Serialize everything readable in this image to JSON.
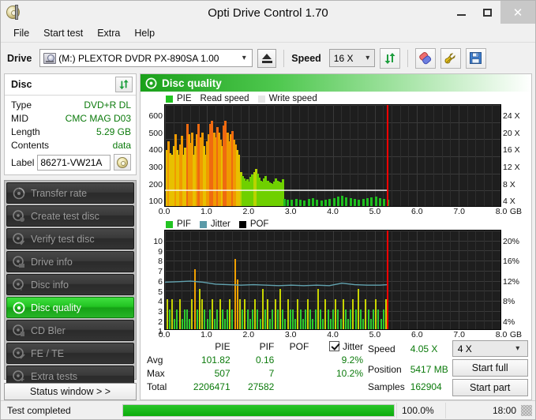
{
  "window": {
    "title": "Opti Drive Control 1.70",
    "icon": "disc-drive-icon",
    "minimize": "–",
    "maximize": "□",
    "close": "✕"
  },
  "menu": {
    "items": [
      "File",
      "Start test",
      "Extra",
      "Help"
    ]
  },
  "toolbar": {
    "drive_label": "Drive",
    "drive_value": "(M:)  PLEXTOR DVDR   PX-890SA 1.00",
    "eject_icon": "eject-icon",
    "speed_label": "Speed",
    "speed_value": "16 X",
    "refresh_icon": "refresh-icon",
    "eraser_icon": "eraser-icon",
    "tools_icon": "tools-icon",
    "save_icon": "save-icon"
  },
  "disc_panel": {
    "title": "Disc",
    "refresh_icon": "refresh-icon",
    "rows": [
      {
        "key": "Type",
        "value": "DVD+R DL"
      },
      {
        "key": "MID",
        "value": "CMC MAG D03"
      },
      {
        "key": "Length",
        "value": "5.29 GB"
      },
      {
        "key": "Contents",
        "value": "data"
      }
    ],
    "label_key": "Label",
    "label_value": "86271-VW21A",
    "label_button_icon": "disc-icon"
  },
  "nav": {
    "items": [
      {
        "label": "Transfer rate",
        "icon": "disc-transfer-icon",
        "active": false
      },
      {
        "label": "Create test disc",
        "icon": "disc-create-icon",
        "active": false
      },
      {
        "label": "Verify test disc",
        "icon": "disc-verify-icon",
        "active": false
      },
      {
        "label": "Drive info",
        "icon": "disc-drive-info-icon",
        "active": false
      },
      {
        "label": "Disc info",
        "icon": "disc-info-icon",
        "active": false
      },
      {
        "label": "Disc quality",
        "icon": "disc-quality-icon",
        "active": true
      },
      {
        "label": "CD Bler",
        "icon": "disc-bler-icon",
        "active": false
      },
      {
        "label": "FE / TE",
        "icon": "disc-fete-icon",
        "active": false
      },
      {
        "label": "Extra tests",
        "icon": "disc-extra-icon",
        "active": false
      }
    ],
    "status_button": "Status window > >"
  },
  "panel": {
    "header_title": "Disc quality",
    "header_icon": "disc-quality-icon"
  },
  "chart_data": [
    {
      "id": "pie-chart",
      "type": "bar",
      "title": "PIE / Read speed",
      "xlabel": "GB",
      "ylabel": "PIE",
      "xlim": [
        0,
        8.0
      ],
      "ylim": [
        0,
        600
      ],
      "y2lim": [
        0,
        24
      ],
      "y2label": "X",
      "grid": true,
      "xticks": [
        "0.0",
        "1.0",
        "2.0",
        "3.0",
        "4.0",
        "5.0",
        "6.0",
        "7.0",
        "8.0"
      ],
      "xtick_suffix": "GB",
      "yticks": [
        600,
        500,
        400,
        300,
        200,
        100
      ],
      "y2ticks": [
        "24 X",
        "20 X",
        "16 X",
        "12 X",
        "8 X",
        "4 X"
      ],
      "legend": [
        {
          "label": "PIE",
          "color": "#22c322"
        },
        {
          "label": "Read speed",
          "color": "#ffffff"
        },
        {
          "label": "Write speed",
          "color": "#e6e6e6"
        }
      ],
      "end_marker_gb": 5.29,
      "end_marker_color": "#ff0000",
      "read_speed_line_x": 4.05,
      "series": [
        {
          "name": "PIE",
          "x": [
            0.02,
            0.06,
            0.1,
            0.14,
            0.18,
            0.22,
            0.26,
            0.3,
            0.34,
            0.38,
            0.42,
            0.46,
            0.5,
            0.54,
            0.58,
            0.62,
            0.66,
            0.7,
            0.74,
            0.78,
            0.82,
            0.86,
            0.9,
            0.94,
            0.98,
            1.02,
            1.06,
            1.1,
            1.14,
            1.18,
            1.22,
            1.26,
            1.3,
            1.34,
            1.38,
            1.42,
            1.46,
            1.5,
            1.54,
            1.58,
            1.62,
            1.66,
            1.7,
            1.74,
            1.78,
            1.82,
            1.86,
            1.9,
            1.94,
            1.98,
            2.02,
            2.06,
            2.1,
            2.14,
            2.18,
            2.22,
            2.26,
            2.3,
            2.34,
            2.38,
            2.42,
            2.46,
            2.5,
            2.54,
            2.58,
            2.62,
            2.66,
            2.7,
            2.74,
            2.78,
            2.82,
            2.9,
            3.0,
            3.1,
            3.2,
            3.3,
            3.4,
            3.5,
            3.6,
            3.7,
            3.8,
            3.9,
            4.0,
            4.1,
            4.2,
            4.3,
            4.4,
            4.5,
            4.6,
            4.7,
            4.8,
            4.9,
            5.0,
            5.1,
            5.2,
            5.28
          ],
          "values": [
            330,
            380,
            310,
            300,
            350,
            420,
            330,
            300,
            360,
            410,
            300,
            340,
            480,
            420,
            370,
            430,
            300,
            350,
            420,
            480,
            400,
            430,
            350,
            300,
            380,
            420,
            480,
            500,
            430,
            400,
            460,
            430,
            390,
            350,
            470,
            500,
            430,
            380,
            420,
            440,
            390,
            360,
            330,
            300,
            200,
            175,
            160,
            150,
            155,
            145,
            170,
            185,
            200,
            215,
            190,
            165,
            150,
            145,
            160,
            175,
            150,
            140,
            135,
            130,
            145,
            160,
            150,
            145,
            140,
            155,
            40,
            35,
            38,
            42,
            36,
            33,
            40,
            45,
            38,
            34,
            37,
            42,
            48,
            55,
            60,
            52,
            45,
            40,
            38,
            42,
            46,
            50,
            55,
            48,
            42,
            38
          ]
        },
        {
          "name": "Read speed",
          "x": [
            0.0,
            2.8,
            5.29
          ],
          "values": [
            4.05,
            4.05,
            4.05
          ]
        }
      ],
      "notes": "PIE bars are color-graded: green (low), yellow/orange (high). Data present only up to the 5.29 GB end marker."
    },
    {
      "id": "pif-chart",
      "type": "bar",
      "title": "PIF / Jitter / POF",
      "xlabel": "GB",
      "ylabel": "PIF",
      "xlim": [
        0,
        8.0
      ],
      "ylim": [
        0,
        10
      ],
      "y2lim": [
        0,
        20
      ],
      "y2label": "%",
      "grid": true,
      "xticks": [
        "0.0",
        "1.0",
        "2.0",
        "3.0",
        "4.0",
        "5.0",
        "6.0",
        "7.0",
        "8.0"
      ],
      "xtick_suffix": "GB",
      "yticks": [
        10,
        9,
        8,
        7,
        6,
        5,
        4,
        3,
        2,
        1
      ],
      "y2ticks": [
        "20%",
        "16%",
        "12%",
        "8%",
        "4%"
      ],
      "legend": [
        {
          "label": "PIF",
          "color": "#22c322"
        },
        {
          "label": "Jitter",
          "color": "#5a9aa8"
        },
        {
          "label": "POF",
          "color": "#000000"
        }
      ],
      "end_marker_gb": 5.29,
      "end_marker_color": "#ff0000",
      "series": [
        {
          "name": "PIF",
          "x": [
            0.03,
            0.09,
            0.15,
            0.21,
            0.27,
            0.33,
            0.39,
            0.45,
            0.51,
            0.57,
            0.63,
            0.69,
            0.75,
            0.81,
            0.87,
            0.93,
            0.99,
            1.05,
            1.11,
            1.17,
            1.23,
            1.29,
            1.35,
            1.41,
            1.47,
            1.53,
            1.59,
            1.65,
            1.71,
            1.77,
            1.83,
            1.89,
            1.95,
            2.01,
            2.07,
            2.13,
            2.19,
            2.25,
            2.31,
            2.37,
            2.43,
            2.49,
            2.55,
            2.61,
            2.67,
            2.73,
            2.79,
            2.85,
            2.91,
            2.97,
            3.03,
            3.09,
            3.15,
            3.21,
            3.27,
            3.33,
            3.39,
            3.45,
            3.51,
            3.57,
            3.63,
            3.69,
            3.75,
            3.81,
            3.87,
            3.93,
            3.99,
            4.05,
            4.11,
            4.17,
            4.23,
            4.29,
            4.35,
            4.41,
            4.47,
            4.53,
            4.59,
            4.65,
            4.71,
            4.77,
            4.83,
            4.89,
            4.95,
            5.01,
            5.07,
            5.13,
            5.19,
            5.25
          ],
          "values": [
            3,
            2,
            3,
            1,
            2,
            3,
            1,
            2,
            2,
            1,
            3,
            6,
            2,
            4,
            3,
            2,
            1,
            2,
            3,
            1,
            2,
            3,
            2,
            1,
            2,
            3,
            2,
            7,
            5,
            3,
            2,
            3,
            2,
            1,
            2,
            3,
            2,
            1,
            4,
            2,
            3,
            1,
            2,
            3,
            2,
            4,
            2,
            1,
            3,
            2,
            2,
            1,
            3,
            2,
            1,
            2,
            3,
            2,
            1,
            2,
            4,
            2,
            1,
            3,
            2,
            1,
            2,
            3,
            2,
            1,
            3,
            2,
            1,
            2,
            3,
            2,
            4,
            2,
            1,
            3,
            2,
            1,
            2,
            3,
            2,
            1,
            2,
            3
          ]
        },
        {
          "name": "Jitter",
          "x": [
            0.0,
            0.3,
            0.6,
            0.9,
            1.2,
            1.5,
            1.8,
            2.1,
            2.4,
            2.7,
            3.0,
            3.3,
            3.6,
            3.9,
            4.2,
            4.5,
            4.8,
            5.1,
            5.29
          ],
          "values": [
            9.7,
            9.8,
            9.9,
            9.7,
            9.3,
            9.2,
            9.1,
            9.2,
            9.1,
            9.0,
            9.1,
            9.0,
            9.1,
            9.0,
            9.5,
            9.2,
            9.1,
            9.1,
            9.2
          ]
        },
        {
          "name": "POF",
          "x": [],
          "values": []
        }
      ],
      "notes": "Jitter plotted on right % axis around 9%. POF zero throughout."
    }
  ],
  "stats": {
    "columns": [
      "PIE",
      "PIF",
      "POF",
      "Jitter"
    ],
    "jitter_checked": true,
    "rows": [
      {
        "label": "Avg",
        "pie": "101.82",
        "pif": "0.16",
        "pof": "",
        "jitter": "9.2%"
      },
      {
        "label": "Max",
        "pie": "507",
        "pif": "7",
        "pof": "",
        "jitter": "10.2%"
      },
      {
        "label": "Total",
        "pie": "2206471",
        "pif": "27582",
        "pof": "",
        "jitter": ""
      }
    ]
  },
  "run_info": {
    "speed_label": "Speed",
    "speed_value": "4.05 X",
    "position_label": "Position",
    "position_value": "5417 MB",
    "samples_label": "Samples",
    "samples_value": "162904",
    "speed_select": "4 X",
    "start_full": "Start full",
    "start_part": "Start part"
  },
  "statusbar": {
    "message": "Test completed",
    "progress_percent": "100.0%",
    "progress_value": 100,
    "elapsed": "18:00"
  },
  "colors": {
    "accent_green": "#22c322",
    "value_green": "#0b7a0b",
    "marker_red": "#ff0000",
    "plot_bg": "#1e1e1e"
  }
}
